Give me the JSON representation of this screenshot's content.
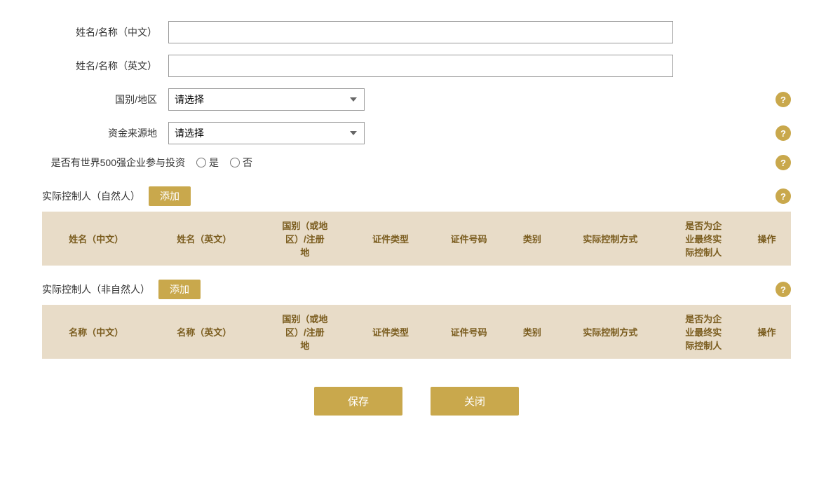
{
  "form": {
    "name_cn_label": "姓名/名称（中文）",
    "name_en_label": "姓名/名称（英文）",
    "country_label": "国别/地区",
    "country_placeholder": "请选择",
    "fund_source_label": "资金来源地",
    "fund_source_placeholder": "请选择",
    "world500_label": "是否有世界500强企业参与投资",
    "radio_yes": "是",
    "radio_no": "否"
  },
  "natural_person_section": {
    "title": "实际控制人（自然人）",
    "add_button": "添加",
    "columns": [
      "姓名（中文）",
      "姓名（英文）",
      "国别（或地区）/注册地",
      "证件类型",
      "证件号码",
      "类别",
      "实际控制方式",
      "是否为企业最终实际控制人",
      "操作"
    ]
  },
  "non_natural_person_section": {
    "title": "实际控制人（非自然人）",
    "add_button": "添加",
    "columns": [
      "名称（中文）",
      "名称（英文）",
      "国别（或地区）/注册地",
      "证件类型",
      "证件号码",
      "类别",
      "实际控制方式",
      "是否为企业最终实际控制人",
      "操作"
    ]
  },
  "buttons": {
    "save": "保存",
    "close": "关闭"
  },
  "help_icon": "?"
}
